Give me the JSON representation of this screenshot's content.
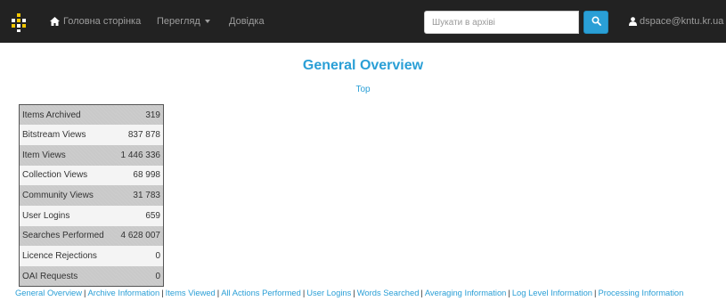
{
  "navbar": {
    "home_label": "Головна сторінка",
    "browse_label": "Перегляд",
    "help_label": "Довідка",
    "search_placeholder": "Шукати в архіві",
    "user_label": "dspace@kntu.kr.ua",
    "icons": {
      "logo": "dspace-logo-icon",
      "home": "home-icon",
      "search": "search-icon",
      "user": "user-icon"
    }
  },
  "main": {
    "title": "General Overview",
    "top_link": "Top",
    "stats": [
      {
        "label": "Items Archived",
        "value": "319"
      },
      {
        "label": "Bitstream Views",
        "value": "837 878"
      },
      {
        "label": "Item Views",
        "value": "1 446 336"
      },
      {
        "label": "Collection Views",
        "value": "68 998"
      },
      {
        "label": "Community Views",
        "value": "31 783"
      },
      {
        "label": "User Logins",
        "value": "659"
      },
      {
        "label": "Searches Performed",
        "value": "4 628 007"
      },
      {
        "label": "Licence Rejections",
        "value": "0"
      },
      {
        "label": "OAI Requests",
        "value": "0"
      }
    ]
  },
  "footer_links": [
    "General Overview",
    "Archive Information",
    "Items Viewed",
    "All Actions Performed",
    "User Logins",
    "Words Searched",
    "Averaging Information",
    "Log Level Information",
    "Processing Information"
  ],
  "colors": {
    "navbar_bg": "#222222",
    "accent": "#2a9fd6",
    "row_dark": "#c9c9c9",
    "row_light": "#f4f4f4"
  }
}
